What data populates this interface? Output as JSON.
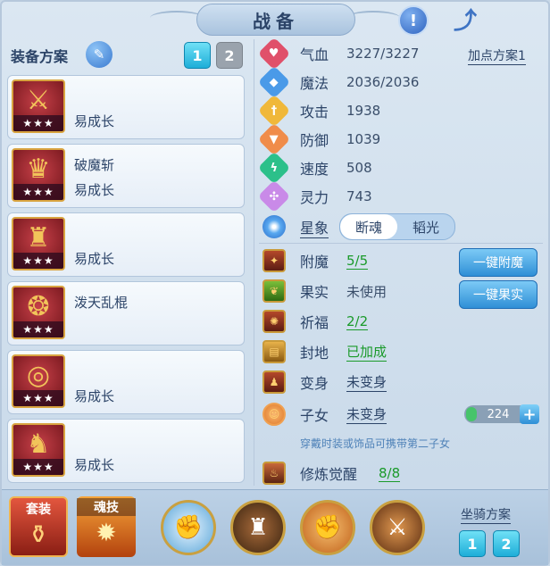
{
  "title": "战备",
  "left_panel": {
    "plan_label": "装备方案",
    "plan_buttons": [
      "1",
      "2"
    ]
  },
  "equipment": [
    {
      "name": "",
      "trait": "易成长",
      "stars": "★★★",
      "icon": "sword-icon"
    },
    {
      "name": "破魔斩",
      "trait": "易成长",
      "stars": "★★★",
      "icon": "helmet-icon"
    },
    {
      "name": "",
      "trait": "易成长",
      "stars": "★★★",
      "icon": "armor-icon"
    },
    {
      "name": "泼天乱棍",
      "trait": "",
      "stars": "★★★",
      "icon": "necklace-icon"
    },
    {
      "name": "",
      "trait": "易成长",
      "stars": "★★★",
      "icon": "belt-icon"
    },
    {
      "name": "",
      "trait": "易成长",
      "stars": "★★★",
      "icon": "boots-icon"
    }
  ],
  "stats": [
    {
      "label": "气血",
      "value": "3227/3227",
      "icon": "heart-icon",
      "color": "#e0506a"
    },
    {
      "label": "魔法",
      "value": "2036/2036",
      "icon": "mana-icon",
      "color": "#4a9ae8"
    },
    {
      "label": "攻击",
      "value": "1938",
      "icon": "attack-icon",
      "color": "#f0b83a"
    },
    {
      "label": "防御",
      "value": "1039",
      "icon": "defense-icon",
      "color": "#f08c4a"
    },
    {
      "label": "速度",
      "value": "508",
      "icon": "speed-icon",
      "color": "#2cc08a"
    },
    {
      "label": "灵力",
      "value": "743",
      "icon": "spirit-icon",
      "color": "#c98ae8"
    }
  ],
  "alloc_plan": "加点方案1",
  "xingxiang": {
    "label": "星象",
    "options": [
      "断魂",
      "韬光"
    ],
    "selected": "断魂"
  },
  "extras": [
    {
      "label": "附魔",
      "value": "5/5",
      "style": "green",
      "icon": "enchant-icon"
    },
    {
      "label": "果实",
      "value": "未使用",
      "style": "gray",
      "icon": "fruit-icon"
    },
    {
      "label": "祈福",
      "value": "2/2",
      "style": "green",
      "icon": "bless-icon"
    },
    {
      "label": "封地",
      "value": "已加成",
      "style": "green",
      "icon": "fief-icon"
    },
    {
      "label": "变身",
      "value": "未变身",
      "style": "link",
      "icon": "transform-icon"
    },
    {
      "label": "子女",
      "value": "未变身",
      "style": "link",
      "icon": "child-icon"
    }
  ],
  "buttons": {
    "enchant": "一键附魔",
    "fruit": "一键果实"
  },
  "child": {
    "count": "224",
    "hint": "穿戴时装或饰品可携带第二子女"
  },
  "cultivation": {
    "label": "修炼觉醒",
    "value": "8/8"
  },
  "bottom": {
    "tab_suit": "套装",
    "tab_soul": "魂技",
    "mount_label": "坐骑方案",
    "mount_buttons": [
      "1",
      "2"
    ]
  }
}
